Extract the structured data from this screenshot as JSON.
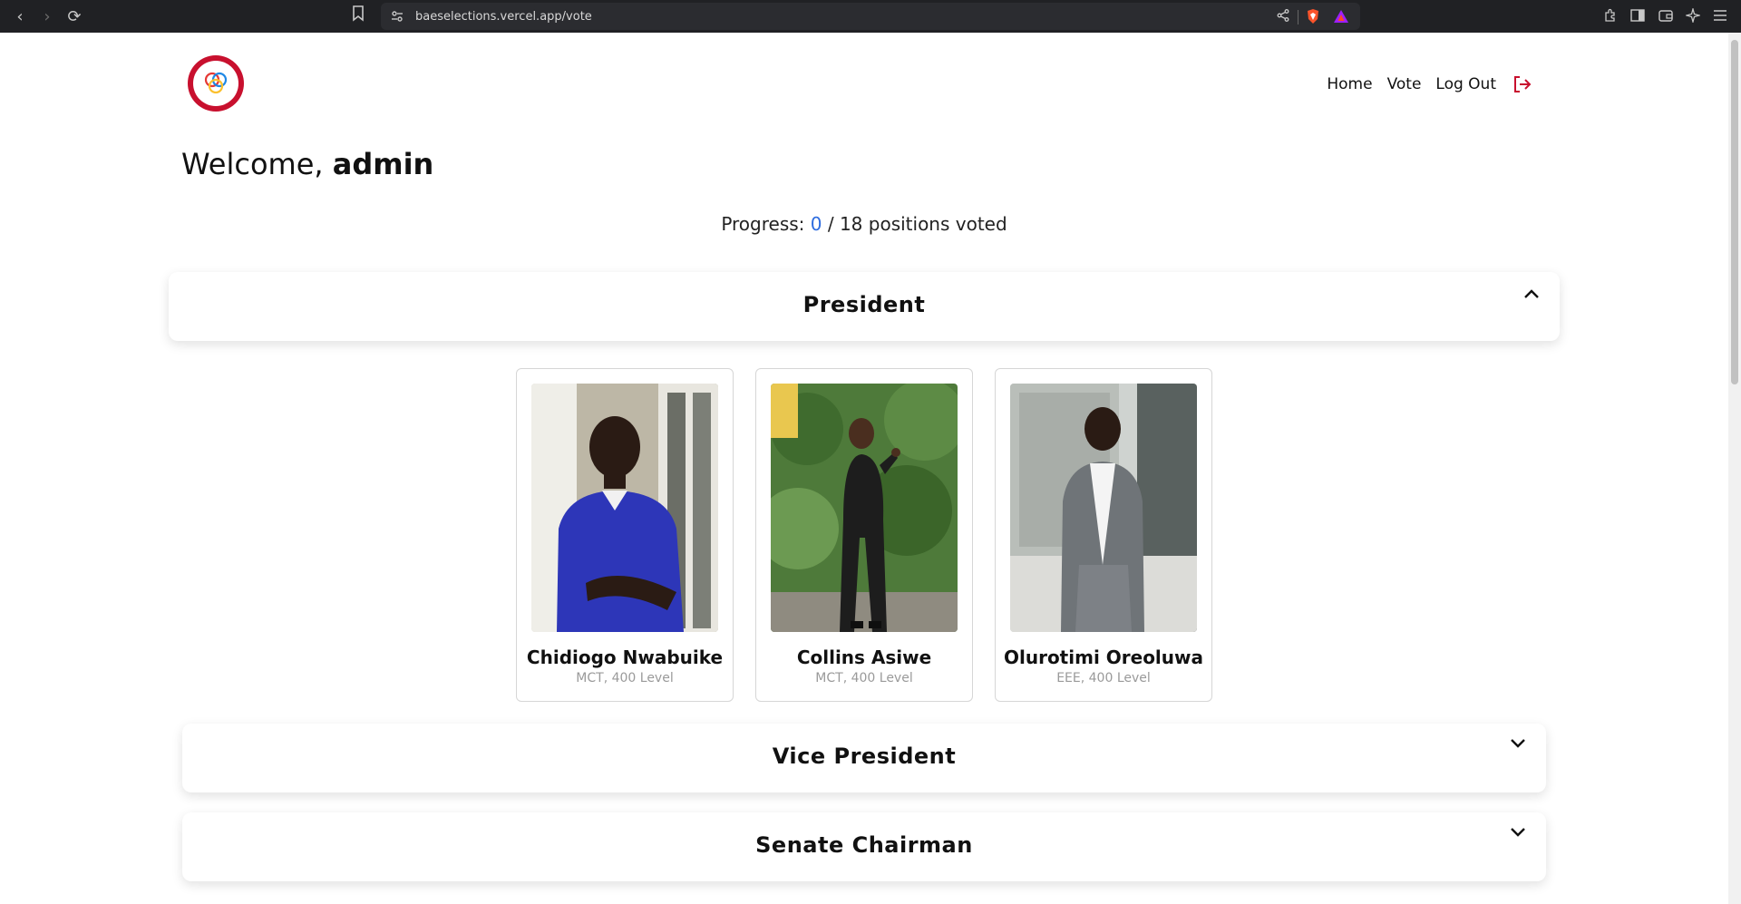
{
  "browser": {
    "url": "baeselections.vercel.app/vote"
  },
  "nav": {
    "home": "Home",
    "vote": "Vote",
    "logout": "Log Out"
  },
  "welcome": {
    "prefix": "Welcome, ",
    "user": "admin"
  },
  "progress": {
    "label": "Progress: ",
    "voted": "0",
    "suffix": " / 18 positions voted"
  },
  "sections": [
    {
      "title": "President",
      "expanded": true,
      "candidates": [
        {
          "name": "Chidiogo Nwabuike",
          "dept": "MCT, 400 Level"
        },
        {
          "name": "Collins Asiwe",
          "dept": "MCT, 400 Level"
        },
        {
          "name": "Olurotimi Oreoluwa",
          "dept": "EEE, 400 Level"
        }
      ]
    },
    {
      "title": "Vice President",
      "expanded": false
    },
    {
      "title": "Senate Chairman",
      "expanded": false
    }
  ],
  "colors": {
    "accent": "#c8102e",
    "progress_count": "#2d6cdf"
  }
}
